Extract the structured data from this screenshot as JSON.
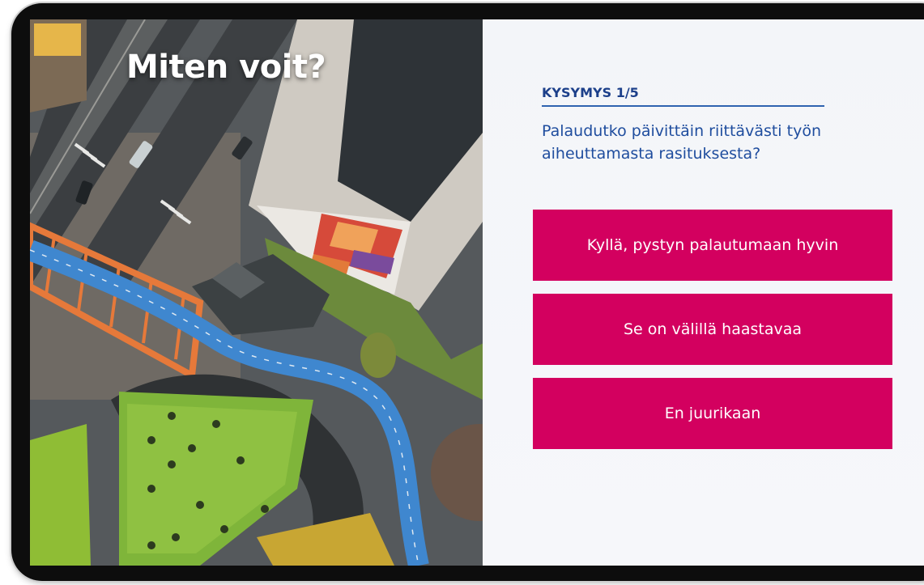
{
  "photo": {
    "title": "Miten voit?"
  },
  "quiz": {
    "question_label": "KYSYMYS 1/5",
    "question_text": "Palaudutko päivittäin riittävästi työn aiheuttamasta rasituksesta?",
    "answers": [
      {
        "label": "Kyllä, pystyn palautumaan hyvin"
      },
      {
        "label": "Se on välillä haastavaa"
      },
      {
        "label": "En juurikaan"
      }
    ]
  },
  "colors": {
    "accent": "#d3005f",
    "heading_blue": "#1c3f8a",
    "text_blue": "#1f4d9e",
    "divider_blue": "#2f63b0",
    "panel_bg": "#f4f6fa",
    "device_frame": "#0d0d0d"
  }
}
